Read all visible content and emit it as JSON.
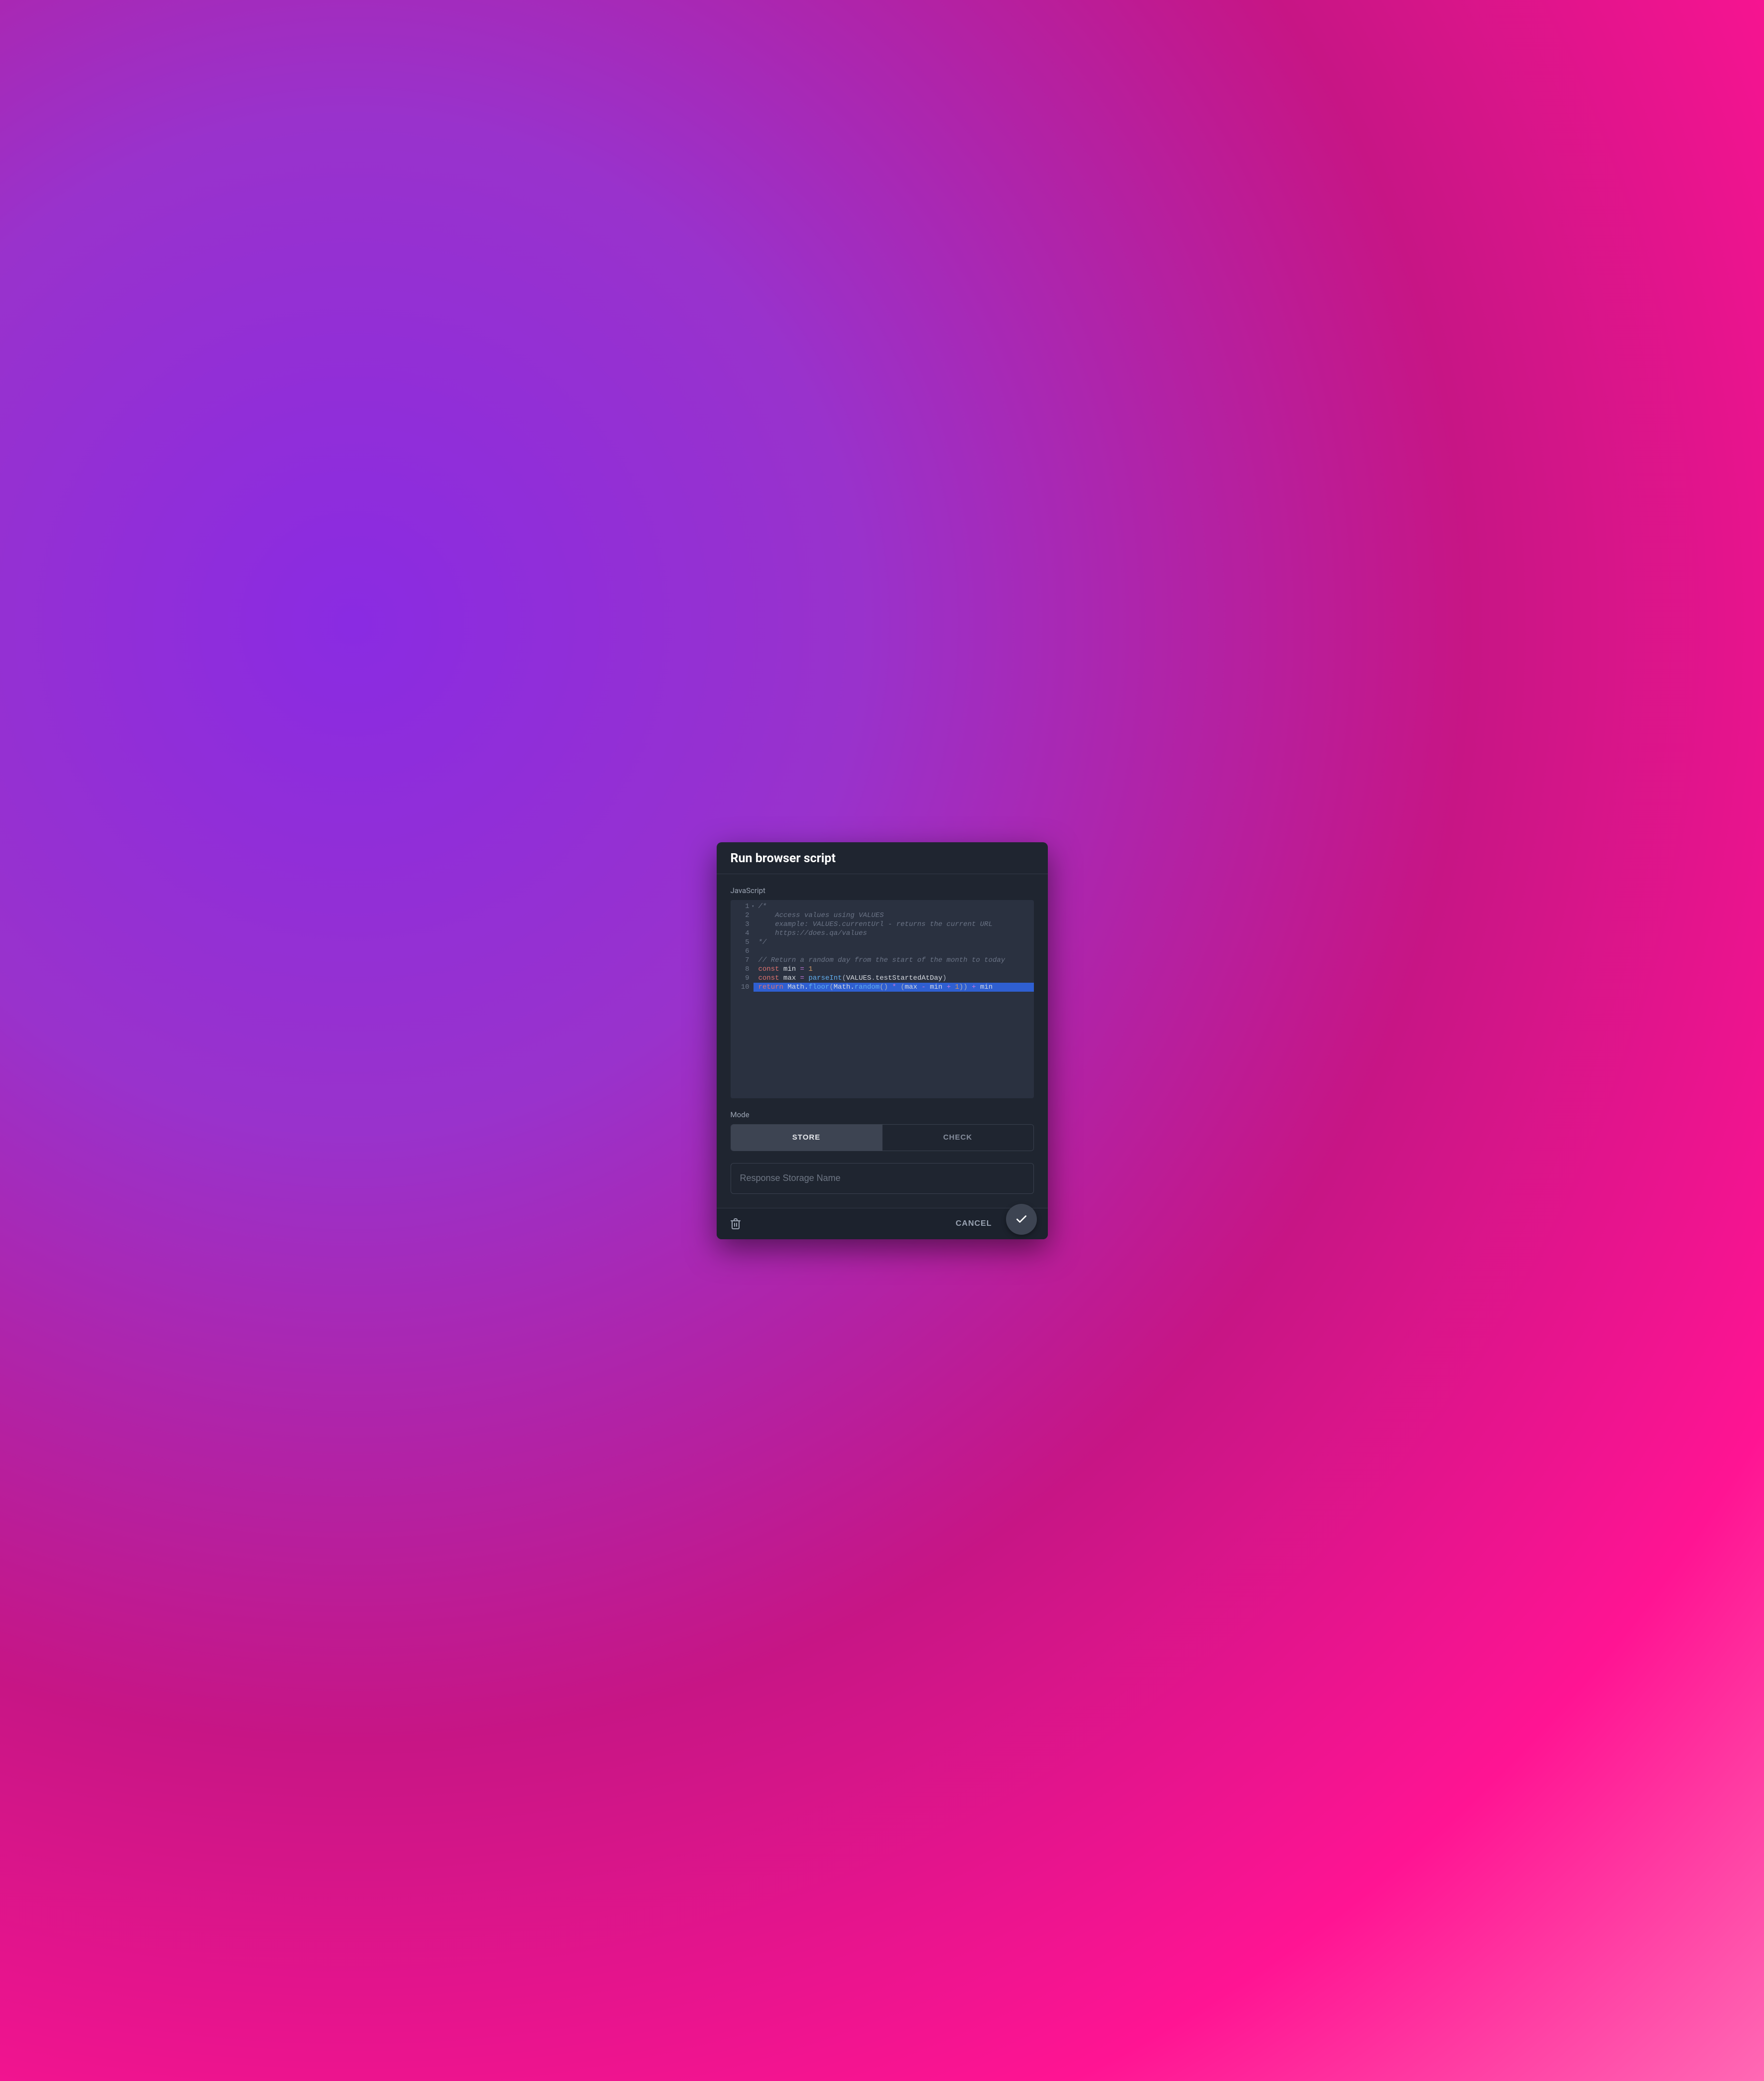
{
  "dialog": {
    "title": "Run browser script"
  },
  "editor": {
    "language_label": "JavaScript",
    "lines": [
      {
        "n": 1,
        "fold": true,
        "highlight": false,
        "tokens": [
          {
            "t": "comment",
            "v": "/*"
          }
        ]
      },
      {
        "n": 2,
        "fold": false,
        "highlight": false,
        "tokens": [
          {
            "t": "comment",
            "v": "    Access values using VALUES"
          }
        ]
      },
      {
        "n": 3,
        "fold": false,
        "highlight": false,
        "tokens": [
          {
            "t": "comment",
            "v": "    example: VALUES.currentUrl - returns the current URL"
          }
        ]
      },
      {
        "n": 4,
        "fold": false,
        "highlight": false,
        "tokens": [
          {
            "t": "comment",
            "v": "    https://does.qa/values"
          }
        ]
      },
      {
        "n": 5,
        "fold": false,
        "highlight": false,
        "tokens": [
          {
            "t": "comment",
            "v": "*/"
          }
        ]
      },
      {
        "n": 6,
        "fold": false,
        "highlight": false,
        "tokens": []
      },
      {
        "n": 7,
        "fold": false,
        "highlight": false,
        "tokens": [
          {
            "t": "comment",
            "v": "// Return a random day from the start of the month to today"
          }
        ]
      },
      {
        "n": 8,
        "fold": false,
        "highlight": false,
        "tokens": [
          {
            "t": "keyword",
            "v": "const"
          },
          {
            "t": "plain",
            "v": " "
          },
          {
            "t": "ident",
            "v": "min"
          },
          {
            "t": "plain",
            "v": " "
          },
          {
            "t": "op",
            "v": "="
          },
          {
            "t": "plain",
            "v": " "
          },
          {
            "t": "num",
            "v": "1"
          }
        ]
      },
      {
        "n": 9,
        "fold": false,
        "highlight": false,
        "tokens": [
          {
            "t": "keyword",
            "v": "const"
          },
          {
            "t": "plain",
            "v": " "
          },
          {
            "t": "ident",
            "v": "max"
          },
          {
            "t": "plain",
            "v": " "
          },
          {
            "t": "op",
            "v": "="
          },
          {
            "t": "plain",
            "v": " "
          },
          {
            "t": "func",
            "v": "parseInt"
          },
          {
            "t": "paren",
            "v": "("
          },
          {
            "t": "ident",
            "v": "VALUES"
          },
          {
            "t": "plain",
            "v": "."
          },
          {
            "t": "ident",
            "v": "testStartedAtDay"
          },
          {
            "t": "paren",
            "v": ")"
          }
        ]
      },
      {
        "n": 10,
        "fold": false,
        "highlight": true,
        "tokens": [
          {
            "t": "keyword",
            "v": "return"
          },
          {
            "t": "plain",
            "v": " "
          },
          {
            "t": "ident",
            "v": "Math"
          },
          {
            "t": "plain",
            "v": "."
          },
          {
            "t": "func",
            "v": "floor"
          },
          {
            "t": "paren",
            "v": "("
          },
          {
            "t": "ident",
            "v": "Math"
          },
          {
            "t": "plain",
            "v": "."
          },
          {
            "t": "func",
            "v": "random"
          },
          {
            "t": "paren",
            "v": "()"
          },
          {
            "t": "plain",
            "v": " "
          },
          {
            "t": "op",
            "v": "*"
          },
          {
            "t": "plain",
            "v": " "
          },
          {
            "t": "paren",
            "v": "("
          },
          {
            "t": "ident",
            "v": "max"
          },
          {
            "t": "plain",
            "v": " "
          },
          {
            "t": "op",
            "v": "-"
          },
          {
            "t": "plain",
            "v": " "
          },
          {
            "t": "ident",
            "v": "min"
          },
          {
            "t": "plain",
            "v": " "
          },
          {
            "t": "op",
            "v": "+"
          },
          {
            "t": "plain",
            "v": " "
          },
          {
            "t": "num",
            "v": "1"
          },
          {
            "t": "paren",
            "v": "))"
          },
          {
            "t": "plain",
            "v": " "
          },
          {
            "t": "op",
            "v": "+"
          },
          {
            "t": "plain",
            "v": " "
          },
          {
            "t": "ident",
            "v": "min"
          }
        ]
      }
    ]
  },
  "mode": {
    "label": "Mode",
    "options": [
      {
        "label": "STORE",
        "active": true
      },
      {
        "label": "CHECK",
        "active": false
      }
    ]
  },
  "input": {
    "placeholder": "Response Storage Name",
    "value": ""
  },
  "footer": {
    "cancel_label": "CANCEL"
  },
  "icons": {
    "trash": "trash-icon",
    "check": "check-icon"
  },
  "colors": {
    "dialog_bg": "#1f2530",
    "editor_bg": "#2a3140",
    "highlight_bg": "#2f5fd1",
    "keyword": "#e0736f",
    "func": "#61afef",
    "op": "#c678dd",
    "num": "#d19a66"
  }
}
